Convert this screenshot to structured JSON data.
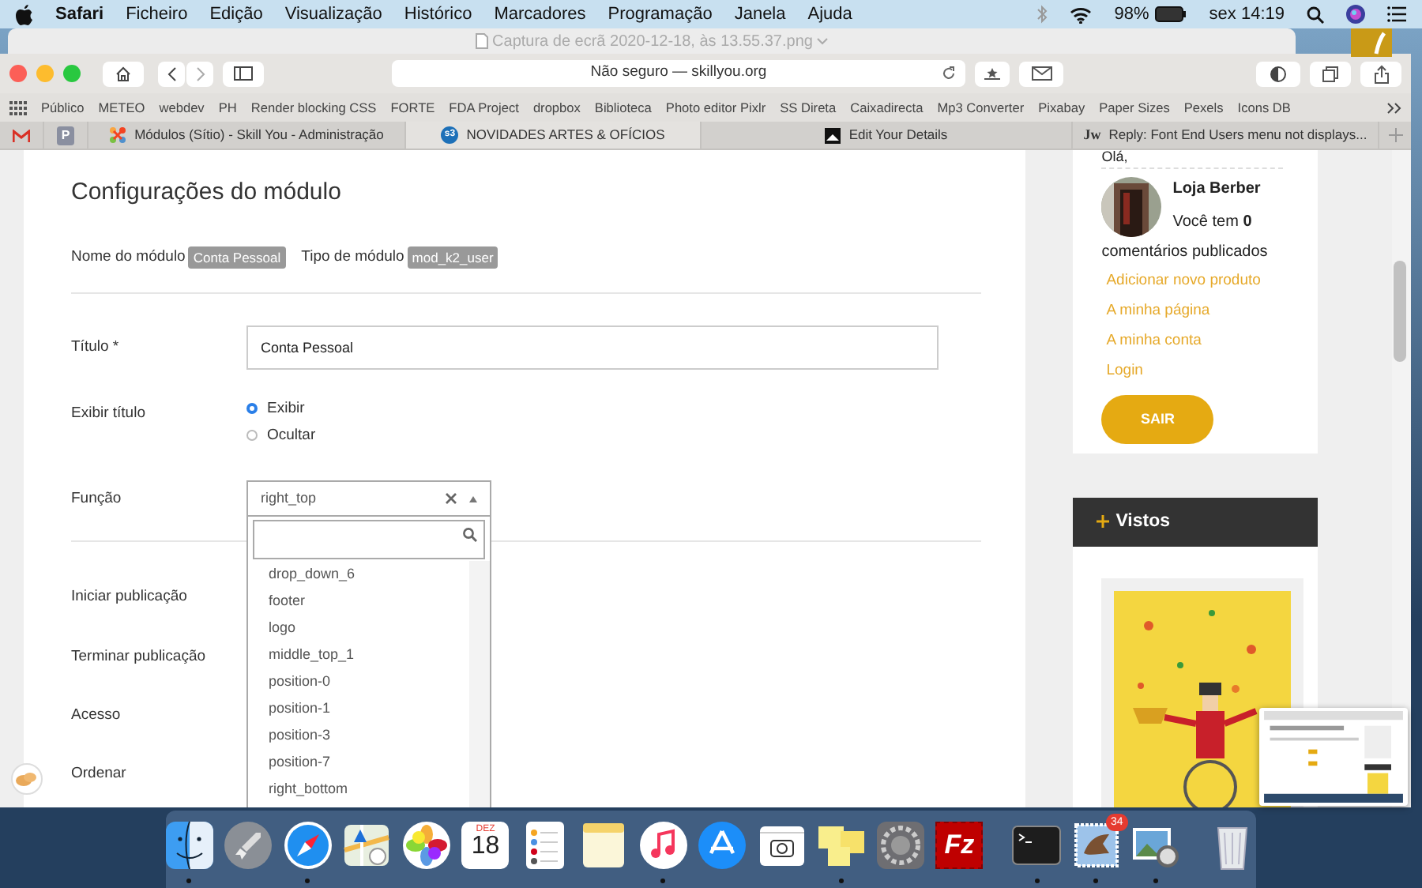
{
  "menubar": {
    "app": "Safari",
    "menus": [
      "Ficheiro",
      "Edição",
      "Visualização",
      "Histórico",
      "Marcadores",
      "Programação",
      "Janela",
      "Ajuda"
    ],
    "battery": "98%",
    "clock": "sex 14:19"
  },
  "background_window": {
    "title": "Captura de ecrã 2020-12-18, às 13.55.37.png"
  },
  "browser": {
    "address": "Não seguro — skillyou.org",
    "bookmarks": [
      "Público",
      "METEO",
      "webdev",
      "PH",
      "Render blocking CSS",
      "FORTE",
      "FDA Project",
      "dropbox",
      "Biblioteca",
      "Photo editor Pixlr",
      "SS Direta",
      "Caixadirecta",
      "Mp3 Converter",
      "Pixabay",
      "Paper Sizes",
      "Pexels",
      "Icons DB"
    ],
    "pinned_tabs": [
      {
        "kind": "gmail"
      },
      {
        "kind": "letter",
        "letter": "P"
      }
    ],
    "tabs": [
      {
        "label": "Módulos (Sítio) - Skill You - Administração",
        "selected": false
      },
      {
        "label": "NOVIDADES ARTES & OFÍCIOS",
        "logo_text": "s3",
        "selected": true
      },
      {
        "label": "Edit Your Details",
        "selected": false
      },
      {
        "label": "Reply: Font End Users menu not displays...",
        "logo_text": "Jw",
        "selected": false
      }
    ]
  },
  "module_form": {
    "heading": "Configurações do módulo",
    "meta": [
      {
        "label": "Nome do módulo",
        "badge": "Conta Pessoal"
      },
      {
        "label": "Tipo de módulo",
        "badge": "mod_k2_user"
      }
    ],
    "fields": [
      {
        "kind": "text",
        "label": "Título *",
        "value": "Conta Pessoal"
      },
      {
        "kind": "radio",
        "label": "Exibir título",
        "options": [
          {
            "label": "Exibir",
            "selected": true
          },
          {
            "label": "Ocultar",
            "selected": false
          }
        ]
      },
      {
        "kind": "select",
        "label": "Função",
        "value": "right_top",
        "expanded": true,
        "options": [
          "drop_down_6",
          "footer",
          "logo",
          "middle_top_1",
          "position-0",
          "position-1",
          "position-3",
          "position-7",
          "right_bottom"
        ]
      },
      {
        "kind": "plain",
        "label": "Iniciar publicação"
      },
      {
        "kind": "plain",
        "label": "Terminar publicação"
      },
      {
        "kind": "plain",
        "label": "Acesso"
      },
      {
        "kind": "plain",
        "label": "Ordenar"
      }
    ]
  },
  "sidebar": {
    "greeting": "Olá,",
    "user_name": "Loja Berber",
    "comments_text": "Você tem **0** comentários publicados",
    "links": [
      "Adicionar novo produto",
      "A minha página",
      "A minha conta",
      "Login"
    ],
    "logout_button": "SAIR",
    "module_title": "Vistos"
  },
  "dock": [
    {
      "kind": "finder",
      "running": true
    },
    {
      "kind": "launchpad",
      "running": false
    },
    {
      "kind": "safari",
      "running": true
    },
    {
      "kind": "maps",
      "running": false
    },
    {
      "kind": "photos",
      "running": false
    },
    {
      "kind": "calendar",
      "month": "DEZ",
      "day": "18",
      "running": false
    },
    {
      "kind": "reminders",
      "running": false
    },
    {
      "kind": "notes",
      "running": false
    },
    {
      "kind": "music",
      "running": true
    },
    {
      "kind": "appstore",
      "running": false
    },
    {
      "kind": "screenshot",
      "running": false
    },
    {
      "kind": "stickies",
      "running": true
    },
    {
      "kind": "settings",
      "running": false
    },
    {
      "kind": "filezilla",
      "label": "Fz",
      "running": false
    },
    {
      "kind": "separator"
    },
    {
      "kind": "terminal",
      "running": true
    },
    {
      "kind": "mail",
      "badge": "34",
      "running": true
    },
    {
      "kind": "preview",
      "running": true
    },
    {
      "kind": "separator"
    },
    {
      "kind": "trash",
      "running": false
    }
  ]
}
